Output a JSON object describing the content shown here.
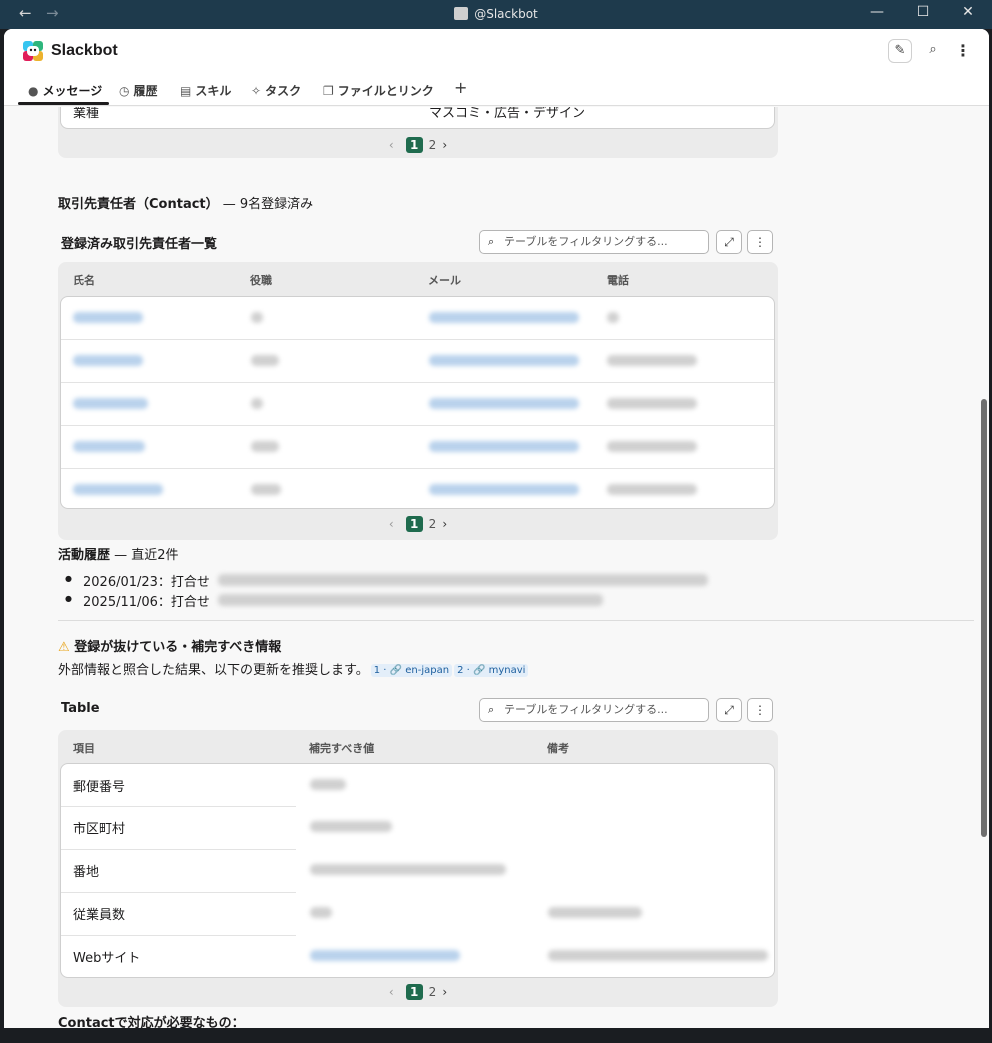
{
  "titlebar": {
    "title": "@Slackbot"
  },
  "header": {
    "app_name": "Slackbot"
  },
  "tabs": [
    {
      "label": "メッセージ",
      "icon": "message-icon"
    },
    {
      "label": "履歴",
      "icon": "history-icon"
    },
    {
      "label": "スキル",
      "icon": "skill-icon"
    },
    {
      "label": "タスク",
      "icon": "task-icon"
    },
    {
      "label": "ファイルとリンク",
      "icon": "files-icon"
    },
    {
      "label": "+",
      "icon": "add-tab-icon"
    }
  ],
  "top_table": {
    "row_label": "業種",
    "row_value": "マスコミ・広告・デザイン",
    "pager": {
      "current": "1",
      "next": "2"
    }
  },
  "contact_section": {
    "heading_bold": "取引先責任者（Contact）",
    "heading_rest": " — 9名登録済み"
  },
  "contact_table": {
    "title": "登録済み取引先責任者一覧",
    "filter_placeholder": "テーブルをフィルタリングする...",
    "columns": [
      "氏名",
      "役職",
      "メール",
      "電話"
    ],
    "pager": {
      "current": "1",
      "next": "2"
    }
  },
  "activity": {
    "heading_bold": "活動履歴",
    "heading_rest": " — 直近2件",
    "items": [
      "2026/01/23：打合せ",
      "2025/11/06：打合せ"
    ]
  },
  "missing_info": {
    "warning_icon": "⚠",
    "heading": "登録が抜けている・補完すべき情報",
    "description": "外部情報と照合した結果、以下の更新を推奨します。",
    "citations": [
      "1 · 🔗 en-japan",
      "2 · 🔗 mynavi"
    ]
  },
  "supplement_table": {
    "title": "Table",
    "filter_placeholder": "テーブルをフィルタリングする...",
    "columns": [
      "項目",
      "補完すべき値",
      "備考"
    ],
    "rows": [
      "郵便番号",
      "市区町村",
      "番地",
      "従業員数",
      "Webサイト"
    ],
    "pager": {
      "current": "1",
      "next": "2"
    }
  },
  "contact_todo": {
    "heading": "Contactで対応が必要なもの："
  },
  "colors": {
    "accent": "#1f6b4e",
    "titlebar": "#1e3a4c",
    "link": "#1d5f9e"
  }
}
